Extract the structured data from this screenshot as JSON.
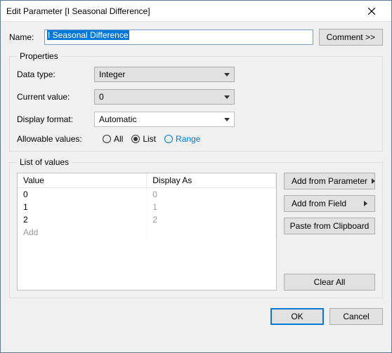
{
  "window": {
    "title": "Edit Parameter [I Seasonal Difference]"
  },
  "name": {
    "label": "Name:",
    "value": "I Seasonal Difference"
  },
  "comment_btn": "Comment >>",
  "properties": {
    "legend": "Properties",
    "data_type": {
      "label": "Data type:",
      "value": "Integer"
    },
    "current_value": {
      "label": "Current value:",
      "value": "0"
    },
    "display_format": {
      "label": "Display format:",
      "value": "Automatic"
    },
    "allowable": {
      "label": "Allowable values:",
      "all": "All",
      "list": "List",
      "range": "Range",
      "selected": "List"
    }
  },
  "list": {
    "legend": "List of values",
    "headers": {
      "value": "Value",
      "display": "Display As"
    },
    "rows": [
      {
        "value": "0",
        "display": "0"
      },
      {
        "value": "1",
        "display": "1"
      },
      {
        "value": "2",
        "display": "2"
      }
    ],
    "add_placeholder": "Add",
    "buttons": {
      "add_param": "Add from Parameter",
      "add_field": "Add from Field",
      "paste": "Paste from Clipboard",
      "clear": "Clear All"
    }
  },
  "footer": {
    "ok": "OK",
    "cancel": "Cancel"
  }
}
